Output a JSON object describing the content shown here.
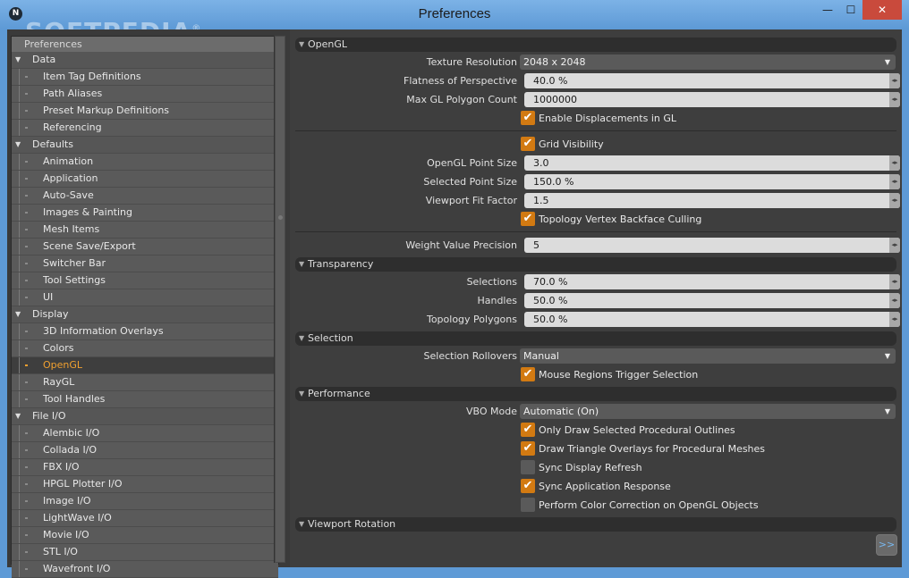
{
  "window": {
    "title": "Preferences",
    "watermark": "SOFTPEDIA",
    "watermark_mark": "®",
    "app_icon": "N",
    "minimize_glyph": "—",
    "maximize_glyph": "☐",
    "close_glyph": "✕"
  },
  "sidebar": {
    "header": "Preferences",
    "tree": [
      {
        "type": "cat",
        "label": "Data"
      },
      {
        "type": "item",
        "label": "Item Tag Definitions"
      },
      {
        "type": "item",
        "label": "Path Aliases"
      },
      {
        "type": "item",
        "label": "Preset Markup Definitions"
      },
      {
        "type": "item",
        "label": "Referencing"
      },
      {
        "type": "cat",
        "label": "Defaults"
      },
      {
        "type": "item",
        "label": "Animation"
      },
      {
        "type": "item",
        "label": "Application"
      },
      {
        "type": "item",
        "label": "Auto-Save"
      },
      {
        "type": "item",
        "label": "Images & Painting"
      },
      {
        "type": "item",
        "label": "Mesh Items"
      },
      {
        "type": "item",
        "label": "Scene Save/Export"
      },
      {
        "type": "item",
        "label": "Switcher Bar"
      },
      {
        "type": "item",
        "label": "Tool Settings"
      },
      {
        "type": "item",
        "label": "UI"
      },
      {
        "type": "cat",
        "label": "Display"
      },
      {
        "type": "item",
        "label": "3D Information Overlays"
      },
      {
        "type": "item",
        "label": "Colors"
      },
      {
        "type": "item",
        "label": "OpenGL",
        "selected": true
      },
      {
        "type": "item",
        "label": "RayGL"
      },
      {
        "type": "item",
        "label": "Tool Handles"
      },
      {
        "type": "cat",
        "label": "File I/O"
      },
      {
        "type": "item",
        "label": "Alembic I/O"
      },
      {
        "type": "item",
        "label": "Collada I/O"
      },
      {
        "type": "item",
        "label": "FBX I/O"
      },
      {
        "type": "item",
        "label": "HPGL Plotter I/O"
      },
      {
        "type": "item",
        "label": "Image I/O"
      },
      {
        "type": "item",
        "label": "LightWave I/O"
      },
      {
        "type": "item",
        "label": "Movie I/O"
      },
      {
        "type": "item",
        "label": "STL I/O"
      },
      {
        "type": "item",
        "label": "Wavefront I/O"
      }
    ]
  },
  "opengl": {
    "title": "OpenGL",
    "texture_resolution": {
      "label": "Texture Resolution",
      "value": "2048 x 2048"
    },
    "flatness": {
      "label": "Flatness of Perspective",
      "value": "40.0 %"
    },
    "max_polygon": {
      "label": "Max GL Polygon Count",
      "value": "1000000"
    },
    "enable_displacements": {
      "label": "Enable Displacements in GL",
      "checked": true
    },
    "grid_visibility": {
      "label": "Grid Visibility",
      "checked": true
    },
    "point_size": {
      "label": "OpenGL Point Size",
      "value": "3.0"
    },
    "selected_point_size": {
      "label": "Selected Point Size",
      "value": "150.0 %"
    },
    "viewport_fit": {
      "label": "Viewport Fit Factor",
      "value": "1.5"
    },
    "topology_culling": {
      "label": "Topology Vertex Backface Culling",
      "checked": true
    },
    "weight_precision": {
      "label": "Weight Value Precision",
      "value": "5"
    }
  },
  "transparency": {
    "title": "Transparency",
    "selections": {
      "label": "Selections",
      "value": "70.0 %"
    },
    "handles": {
      "label": "Handles",
      "value": "50.0 %"
    },
    "topology_polygons": {
      "label": "Topology Polygons",
      "value": "50.0 %"
    }
  },
  "selection": {
    "title": "Selection",
    "rollovers": {
      "label": "Selection Rollovers",
      "value": "Manual"
    },
    "mouse_regions": {
      "label": "Mouse Regions Trigger Selection",
      "checked": true
    }
  },
  "performance": {
    "title": "Performance",
    "vbo_mode": {
      "label": "VBO Mode",
      "value": "Automatic (On)"
    },
    "only_draw_selected": {
      "label": "Only Draw Selected Procedural Outlines",
      "checked": true
    },
    "draw_triangle_overlays": {
      "label": "Draw Triangle Overlays for Procedural Meshes",
      "checked": true
    },
    "sync_display_refresh": {
      "label": "Sync Display Refresh",
      "checked": false
    },
    "sync_application_response": {
      "label": "Sync Application Response",
      "checked": true
    },
    "perform_color_correction": {
      "label": "Perform Color Correction on OpenGL Objects",
      "checked": false
    }
  },
  "viewport_rotation": {
    "title": "Viewport Rotation"
  },
  "glyphs": {
    "check": "✔",
    "section_arrow": "▼",
    "tree_arrow": "▼",
    "caret": "▼",
    "spin": "◂▸",
    "expand": ">>"
  },
  "colors": {
    "accent": "#d27a12",
    "selected_text": "#f0a030",
    "panel_bg": "#3e3e3e",
    "field_bg": "#dcdcdc"
  }
}
